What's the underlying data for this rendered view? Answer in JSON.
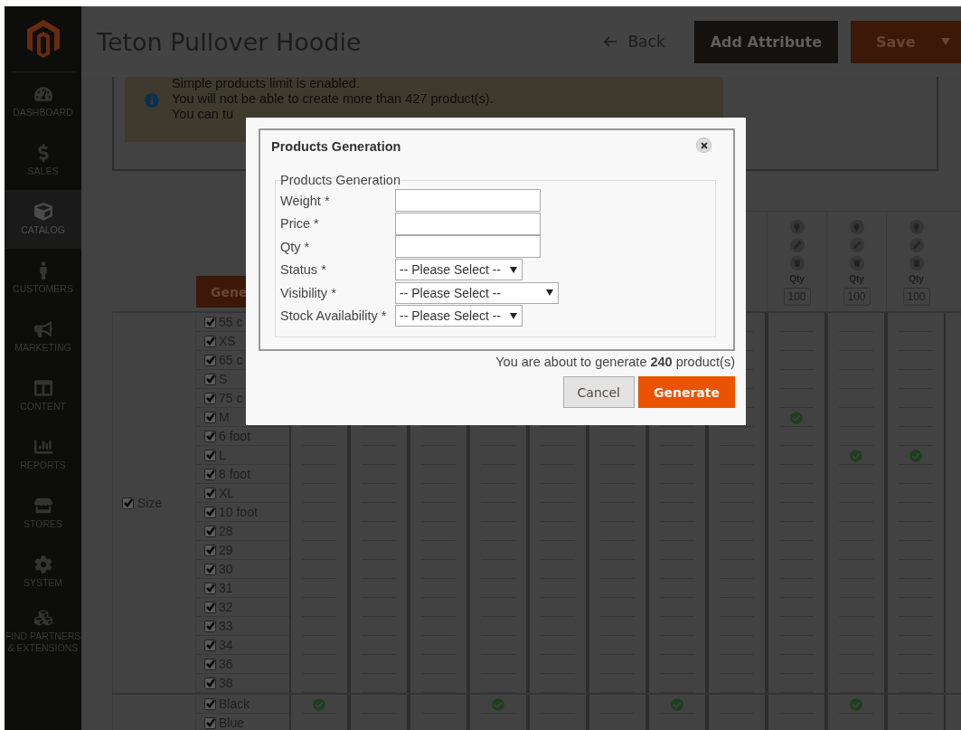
{
  "sidebar": {
    "items": [
      {
        "label": "DASHBOARD",
        "selected": false
      },
      {
        "label": "SALES",
        "selected": false
      },
      {
        "label": "CATALOG",
        "selected": true
      },
      {
        "label": "CUSTOMERS",
        "selected": false
      },
      {
        "label": "MARKETING",
        "selected": false
      },
      {
        "label": "CONTENT",
        "selected": false
      },
      {
        "label": "REPORTS",
        "selected": false
      },
      {
        "label": "STORES",
        "selected": false
      },
      {
        "label": "SYSTEM",
        "selected": false
      },
      {
        "label": "FIND PARTNERS & EXTENSIONS",
        "selected": false
      }
    ]
  },
  "header": {
    "title": "Teton Pullover Hoodie",
    "back": "Back",
    "add_attribute": "Add Attribute",
    "save": "Save"
  },
  "notice": {
    "lines": [
      "Simple products limit is enabled.",
      "You will not be able to create more than 427 product(s).",
      "You can tu"
    ]
  },
  "matrix": {
    "generate_button": "Gene",
    "column_headers": [
      {
        "qty_label": "Qty",
        "qty": "100"
      },
      {
        "qty_label": "Qty",
        "qty": "100"
      },
      {
        "qty_label": "Qty",
        "qty": "100"
      }
    ],
    "groups": [
      {
        "label": "Size",
        "checked": true,
        "values": [
          {
            "label": "55 c",
            "checked": true,
            "cells": [
              false,
              false,
              false,
              false
            ]
          },
          {
            "label": "XS",
            "checked": true,
            "cells": [
              false,
              false,
              false,
              false
            ]
          },
          {
            "label": "65 c",
            "checked": true,
            "cells": [
              false,
              false,
              false,
              false
            ]
          },
          {
            "label": "S",
            "checked": true,
            "cells": [
              false,
              false,
              false,
              false
            ]
          },
          {
            "label": "75 c",
            "checked": true,
            "cells": [
              false,
              false,
              false,
              false
            ]
          },
          {
            "label": "M",
            "checked": true,
            "cells": [
              false,
              true,
              false,
              false
            ]
          },
          {
            "label": "6 foot",
            "checked": true,
            "cells": [
              false,
              false,
              false,
              false,
              false,
              false,
              false,
              false,
              false,
              false,
              false
            ]
          },
          {
            "label": "L",
            "checked": true,
            "cells": [
              false,
              false,
              false,
              false,
              false,
              false,
              false,
              false,
              false,
              true,
              true
            ]
          },
          {
            "label": "8 foot",
            "checked": true,
            "cells": [
              false,
              false,
              false,
              false,
              false,
              false,
              false,
              false,
              false,
              false,
              false
            ]
          },
          {
            "label": "XL",
            "checked": true,
            "cells": [
              false,
              false,
              false,
              false,
              false,
              false,
              false,
              false,
              false,
              false,
              false
            ]
          },
          {
            "label": "10 foot",
            "checked": true,
            "cells": [
              false,
              false,
              false,
              false,
              false,
              false,
              false,
              false,
              false,
              false,
              false
            ]
          },
          {
            "label": "28",
            "checked": true,
            "cells": [
              false,
              false,
              false,
              false,
              false,
              false,
              false,
              false,
              false,
              false,
              false
            ]
          },
          {
            "label": "29",
            "checked": true,
            "cells": [
              false,
              false,
              false,
              false,
              false,
              false,
              false,
              false,
              false,
              false,
              false
            ]
          },
          {
            "label": "30",
            "checked": true,
            "cells": [
              false,
              false,
              false,
              false,
              false,
              false,
              false,
              false,
              false,
              false,
              false
            ]
          },
          {
            "label": "31",
            "checked": true,
            "cells": [
              false,
              false,
              false,
              false,
              false,
              false,
              false,
              false,
              false,
              false,
              false
            ]
          },
          {
            "label": "32",
            "checked": true,
            "cells": [
              false,
              false,
              false,
              false,
              false,
              false,
              false,
              false,
              false,
              false,
              false
            ]
          },
          {
            "label": "33",
            "checked": true,
            "cells": [
              false,
              false,
              false,
              false,
              false,
              false,
              false,
              false,
              false,
              false,
              false
            ]
          },
          {
            "label": "34",
            "checked": true,
            "cells": [
              false,
              false,
              false,
              false,
              false,
              false,
              false,
              false,
              false,
              false,
              false
            ]
          },
          {
            "label": "36",
            "checked": true,
            "cells": [
              false,
              false,
              false,
              false,
              false,
              false,
              false,
              false,
              false,
              false,
              false
            ]
          },
          {
            "label": "38",
            "checked": true,
            "cells": [
              false,
              false,
              false,
              false,
              false,
              false,
              false,
              false,
              false,
              false,
              false
            ]
          }
        ]
      },
      {
        "values": [
          {
            "label": "Black",
            "checked": true,
            "cells": [
              true,
              false,
              false,
              true,
              false,
              false,
              true,
              false,
              false,
              true,
              false
            ]
          },
          {
            "label": "Blue",
            "checked": true,
            "cells": [
              false,
              false,
              false,
              false,
              false,
              false,
              false,
              false,
              false,
              false,
              false
            ]
          }
        ]
      }
    ]
  },
  "dialog": {
    "title": "Products Generation",
    "legend": "Products Generation",
    "fields": [
      {
        "label": "Weight *",
        "kind": "text"
      },
      {
        "label": "Price *",
        "kind": "text"
      },
      {
        "label": "Qty *",
        "kind": "text"
      },
      {
        "label": "Status *",
        "kind": "select",
        "value": "-- Please Select --"
      },
      {
        "label": "Visibility *",
        "kind": "select",
        "value": "-- Please Select --"
      },
      {
        "label": "Stock Availability *",
        "kind": "select",
        "value": "-- Please Select --"
      }
    ],
    "summary": "You are about to generate **240** product(s)",
    "buttons": [
      {
        "label": "Cancel",
        "kind": "secondary"
      },
      {
        "label": "Generate",
        "kind": "primary"
      }
    ]
  }
}
